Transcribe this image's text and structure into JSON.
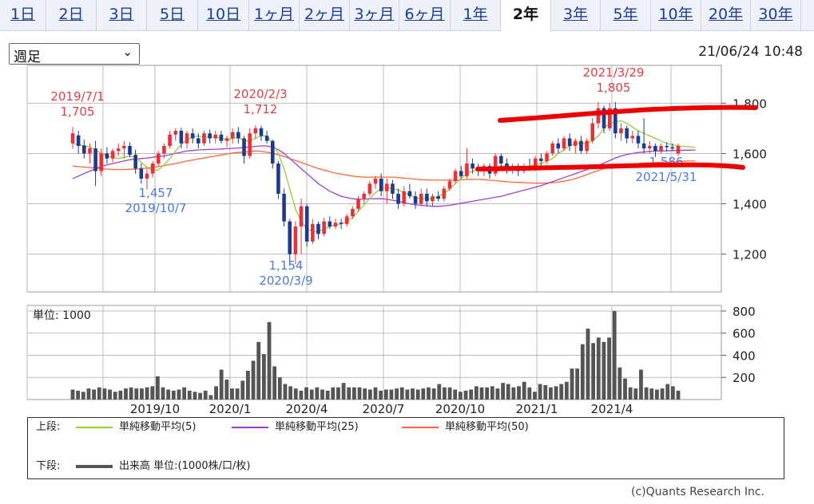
{
  "tabs": [
    {
      "label": "1日"
    },
    {
      "label": "2日"
    },
    {
      "label": "3日"
    },
    {
      "label": "5日"
    },
    {
      "label": "10日"
    },
    {
      "label": "1ヶ月"
    },
    {
      "label": "2ヶ月"
    },
    {
      "label": "3ヶ月"
    },
    {
      "label": "6ヶ月"
    },
    {
      "label": "1年"
    },
    {
      "label": "2年"
    },
    {
      "label": "3年"
    },
    {
      "label": "5年"
    },
    {
      "label": "10年"
    },
    {
      "label": "20年"
    },
    {
      "label": "30年"
    }
  ],
  "active_tab": "2年",
  "period_select": {
    "value": "週足"
  },
  "timestamp": "21/06/24 10:48",
  "colors": {
    "up_candle": "#e8323a",
    "down_candle": "#1d3a8c",
    "ma5": "#9acd32",
    "ma25": "#a040d0",
    "ma50": "#ff6633",
    "volume": "#555555",
    "grid": "#aaaaaa",
    "annotation_high": "#e04040",
    "annotation_low": "#4a78e0",
    "marker": "#ee0000",
    "tab_link": "#1a3c9a"
  },
  "chart_data": [
    {
      "type": "candlestick",
      "ylim": [
        1050,
        1950
      ],
      "y_ticks": [
        "1,800",
        "1,600",
        "1,400",
        "1,200"
      ],
      "x_ticks": [
        "2019/10",
        "2020/1",
        "2020/4",
        "2020/7",
        "2020/10",
        "2021/1",
        "2021/4"
      ],
      "annotations": [
        {
          "date": "2019/7/1",
          "value": "1,705",
          "kind": "high"
        },
        {
          "date": "2020/2/3",
          "value": "1,712",
          "kind": "high"
        },
        {
          "date": "2021/3/29",
          "value": "1,805",
          "kind": "high"
        },
        {
          "date": "2019/10/7",
          "value": "1,457",
          "kind": "low"
        },
        {
          "date": "2020/3/9",
          "value": "1,154",
          "kind": "low"
        },
        {
          "date": "2021/5/31",
          "value": "1,586",
          "kind": "low"
        }
      ],
      "weeks": [
        {
          "o": 1640,
          "h": 1705,
          "l": 1620,
          "c": 1680
        },
        {
          "o": 1672,
          "h": 1690,
          "l": 1600,
          "c": 1630
        },
        {
          "o": 1632,
          "h": 1655,
          "l": 1580,
          "c": 1600
        },
        {
          "o": 1600,
          "h": 1640,
          "l": 1560,
          "c": 1620
        },
        {
          "o": 1620,
          "h": 1650,
          "l": 1470,
          "c": 1530
        },
        {
          "o": 1530,
          "h": 1620,
          "l": 1510,
          "c": 1600
        },
        {
          "o": 1600,
          "h": 1625,
          "l": 1560,
          "c": 1580
        },
        {
          "o": 1580,
          "h": 1620,
          "l": 1565,
          "c": 1610
        },
        {
          "o": 1610,
          "h": 1640,
          "l": 1590,
          "c": 1620
        },
        {
          "o": 1620,
          "h": 1650,
          "l": 1580,
          "c": 1630
        },
        {
          "o": 1630,
          "h": 1645,
          "l": 1585,
          "c": 1595
        },
        {
          "o": 1595,
          "h": 1615,
          "l": 1520,
          "c": 1540
        },
        {
          "o": 1540,
          "h": 1560,
          "l": 1480,
          "c": 1500
        },
        {
          "o": 1500,
          "h": 1540,
          "l": 1457,
          "c": 1520
        },
        {
          "o": 1520,
          "h": 1570,
          "l": 1505,
          "c": 1560
        },
        {
          "o": 1560,
          "h": 1610,
          "l": 1550,
          "c": 1600
        },
        {
          "o": 1600,
          "h": 1640,
          "l": 1580,
          "c": 1630
        },
        {
          "o": 1630,
          "h": 1690,
          "l": 1620,
          "c": 1675
        },
        {
          "o": 1675,
          "h": 1700,
          "l": 1650,
          "c": 1690
        },
        {
          "o": 1690,
          "h": 1702,
          "l": 1620,
          "c": 1640
        },
        {
          "o": 1640,
          "h": 1690,
          "l": 1620,
          "c": 1680
        },
        {
          "o": 1680,
          "h": 1700,
          "l": 1640,
          "c": 1660
        },
        {
          "o": 1660,
          "h": 1680,
          "l": 1620,
          "c": 1640
        },
        {
          "o": 1640,
          "h": 1690,
          "l": 1630,
          "c": 1680
        },
        {
          "o": 1680,
          "h": 1695,
          "l": 1640,
          "c": 1660
        },
        {
          "o": 1660,
          "h": 1690,
          "l": 1640,
          "c": 1675
        },
        {
          "o": 1675,
          "h": 1690,
          "l": 1640,
          "c": 1650
        },
        {
          "o": 1650,
          "h": 1670,
          "l": 1625,
          "c": 1660
        },
        {
          "o": 1660,
          "h": 1700,
          "l": 1640,
          "c": 1685
        },
        {
          "o": 1685,
          "h": 1705,
          "l": 1640,
          "c": 1660
        },
        {
          "o": 1660,
          "h": 1670,
          "l": 1560,
          "c": 1590
        },
        {
          "o": 1590,
          "h": 1700,
          "l": 1580,
          "c": 1680
        },
        {
          "o": 1680,
          "h": 1712,
          "l": 1660,
          "c": 1700
        },
        {
          "o": 1700,
          "h": 1710,
          "l": 1650,
          "c": 1670
        },
        {
          "o": 1670,
          "h": 1690,
          "l": 1640,
          "c": 1650
        },
        {
          "o": 1650,
          "h": 1655,
          "l": 1540,
          "c": 1560
        },
        {
          "o": 1560,
          "h": 1570,
          "l": 1420,
          "c": 1440
        },
        {
          "o": 1440,
          "h": 1460,
          "l": 1310,
          "c": 1330
        },
        {
          "o": 1330,
          "h": 1340,
          "l": 1154,
          "c": 1200
        },
        {
          "o": 1200,
          "h": 1330,
          "l": 1160,
          "c": 1310
        },
        {
          "o": 1310,
          "h": 1420,
          "l": 1200,
          "c": 1390
        },
        {
          "o": 1390,
          "h": 1400,
          "l": 1230,
          "c": 1250
        },
        {
          "o": 1250,
          "h": 1340,
          "l": 1240,
          "c": 1320
        },
        {
          "o": 1320,
          "h": 1330,
          "l": 1260,
          "c": 1280
        },
        {
          "o": 1280,
          "h": 1345,
          "l": 1270,
          "c": 1330
        },
        {
          "o": 1330,
          "h": 1350,
          "l": 1300,
          "c": 1310
        },
        {
          "o": 1310,
          "h": 1340,
          "l": 1300,
          "c": 1325
        },
        {
          "o": 1325,
          "h": 1340,
          "l": 1300,
          "c": 1320
        },
        {
          "o": 1320,
          "h": 1360,
          "l": 1310,
          "c": 1350
        },
        {
          "o": 1350,
          "h": 1390,
          "l": 1340,
          "c": 1380
        },
        {
          "o": 1380,
          "h": 1430,
          "l": 1370,
          "c": 1420
        },
        {
          "o": 1420,
          "h": 1450,
          "l": 1400,
          "c": 1440
        },
        {
          "o": 1440,
          "h": 1490,
          "l": 1430,
          "c": 1480
        },
        {
          "o": 1480,
          "h": 1510,
          "l": 1460,
          "c": 1500
        },
        {
          "o": 1500,
          "h": 1520,
          "l": 1430,
          "c": 1450
        },
        {
          "o": 1450,
          "h": 1500,
          "l": 1400,
          "c": 1480
        },
        {
          "o": 1480,
          "h": 1495,
          "l": 1420,
          "c": 1440
        },
        {
          "o": 1440,
          "h": 1460,
          "l": 1380,
          "c": 1400
        },
        {
          "o": 1400,
          "h": 1470,
          "l": 1390,
          "c": 1450
        },
        {
          "o": 1450,
          "h": 1480,
          "l": 1420,
          "c": 1430
        },
        {
          "o": 1430,
          "h": 1450,
          "l": 1380,
          "c": 1400
        },
        {
          "o": 1400,
          "h": 1460,
          "l": 1390,
          "c": 1440
        },
        {
          "o": 1440,
          "h": 1460,
          "l": 1390,
          "c": 1410
        },
        {
          "o": 1410,
          "h": 1440,
          "l": 1390,
          "c": 1430
        },
        {
          "o": 1430,
          "h": 1450,
          "l": 1410,
          "c": 1420
        },
        {
          "o": 1420,
          "h": 1470,
          "l": 1410,
          "c": 1460
        },
        {
          "o": 1460,
          "h": 1500,
          "l": 1450,
          "c": 1490
        },
        {
          "o": 1490,
          "h": 1540,
          "l": 1480,
          "c": 1530
        },
        {
          "o": 1530,
          "h": 1550,
          "l": 1500,
          "c": 1510
        },
        {
          "o": 1510,
          "h": 1620,
          "l": 1500,
          "c": 1560
        },
        {
          "o": 1560,
          "h": 1580,
          "l": 1520,
          "c": 1540
        },
        {
          "o": 1540,
          "h": 1560,
          "l": 1510,
          "c": 1530
        },
        {
          "o": 1530,
          "h": 1560,
          "l": 1510,
          "c": 1550
        },
        {
          "o": 1550,
          "h": 1560,
          "l": 1500,
          "c": 1520
        },
        {
          "o": 1520,
          "h": 1600,
          "l": 1510,
          "c": 1590
        },
        {
          "o": 1590,
          "h": 1600,
          "l": 1530,
          "c": 1560
        },
        {
          "o": 1560,
          "h": 1580,
          "l": 1520,
          "c": 1540
        },
        {
          "o": 1540,
          "h": 1560,
          "l": 1520,
          "c": 1550
        },
        {
          "o": 1550,
          "h": 1560,
          "l": 1510,
          "c": 1530
        },
        {
          "o": 1530,
          "h": 1560,
          "l": 1520,
          "c": 1550
        },
        {
          "o": 1550,
          "h": 1580,
          "l": 1530,
          "c": 1540
        },
        {
          "o": 1540,
          "h": 1590,
          "l": 1530,
          "c": 1580
        },
        {
          "o": 1580,
          "h": 1600,
          "l": 1550,
          "c": 1570
        },
        {
          "o": 1570,
          "h": 1610,
          "l": 1560,
          "c": 1600
        },
        {
          "o": 1600,
          "h": 1650,
          "l": 1590,
          "c": 1640
        },
        {
          "o": 1640,
          "h": 1660,
          "l": 1600,
          "c": 1620
        },
        {
          "o": 1620,
          "h": 1670,
          "l": 1610,
          "c": 1660
        },
        {
          "o": 1660,
          "h": 1680,
          "l": 1610,
          "c": 1630
        },
        {
          "o": 1630,
          "h": 1660,
          "l": 1600,
          "c": 1650
        },
        {
          "o": 1650,
          "h": 1670,
          "l": 1600,
          "c": 1610
        },
        {
          "o": 1610,
          "h": 1660,
          "l": 1600,
          "c": 1650
        },
        {
          "o": 1650,
          "h": 1740,
          "l": 1640,
          "c": 1720
        },
        {
          "o": 1720,
          "h": 1805,
          "l": 1700,
          "c": 1780
        },
        {
          "o": 1780,
          "h": 1790,
          "l": 1680,
          "c": 1700
        },
        {
          "o": 1700,
          "h": 1800,
          "l": 1690,
          "c": 1780
        },
        {
          "o": 1780,
          "h": 1805,
          "l": 1660,
          "c": 1680
        },
        {
          "o": 1680,
          "h": 1720,
          "l": 1650,
          "c": 1700
        },
        {
          "o": 1700,
          "h": 1710,
          "l": 1640,
          "c": 1660
        },
        {
          "o": 1660,
          "h": 1690,
          "l": 1640,
          "c": 1670
        },
        {
          "o": 1670,
          "h": 1690,
          "l": 1620,
          "c": 1640
        },
        {
          "o": 1640,
          "h": 1740,
          "l": 1600,
          "c": 1620
        },
        {
          "o": 1620,
          "h": 1650,
          "l": 1600,
          "c": 1630
        },
        {
          "o": 1630,
          "h": 1640,
          "l": 1586,
          "c": 1610
        },
        {
          "o": 1610,
          "h": 1640,
          "l": 1600,
          "c": 1630
        },
        {
          "o": 1630,
          "h": 1645,
          "l": 1610,
          "c": 1625
        },
        {
          "o": 1625,
          "h": 1640,
          "l": 1610,
          "c": 1620
        },
        {
          "o": 1600,
          "h": 1640,
          "l": 1590,
          "c": 1630
        }
      ],
      "ma5": [
        1640,
        1635,
        1630,
        1625,
        1615,
        1600,
        1590,
        1585,
        1580,
        1585,
        1590,
        1585,
        1565,
        1545,
        1530,
        1535,
        1555,
        1580,
        1610,
        1635,
        1655,
        1665,
        1670,
        1665,
        1665,
        1665,
        1660,
        1655,
        1660,
        1665,
        1650,
        1650,
        1660,
        1670,
        1670,
        1640,
        1600,
        1540,
        1460,
        1380,
        1330,
        1300,
        1290,
        1290,
        1300,
        1310,
        1315,
        1320,
        1330,
        1345,
        1370,
        1395,
        1420,
        1445,
        1460,
        1465,
        1460,
        1455,
        1445,
        1435,
        1425,
        1420,
        1420,
        1420,
        1430,
        1440,
        1460,
        1480,
        1500,
        1520,
        1530,
        1535,
        1540,
        1540,
        1545,
        1550,
        1550,
        1545,
        1545,
        1545,
        1550,
        1555,
        1560,
        1570,
        1580,
        1600,
        1615,
        1630,
        1640,
        1640,
        1640,
        1650,
        1670,
        1700,
        1720,
        1725,
        1730,
        1720,
        1705,
        1690,
        1680,
        1670,
        1660,
        1650,
        1640,
        1635,
        1630,
        1628,
        1626,
        1625
      ],
      "ma25": [
        1500,
        1510,
        1520,
        1530,
        1540,
        1548,
        1555,
        1560,
        1565,
        1570,
        1575,
        1578,
        1580,
        1582,
        1585,
        1588,
        1590,
        1595,
        1600,
        1605,
        1610,
        1612,
        1614,
        1615,
        1616,
        1617,
        1618,
        1619,
        1620,
        1622,
        1624,
        1626,
        1628,
        1630,
        1630,
        1625,
        1615,
        1600,
        1580,
        1560,
        1540,
        1520,
        1500,
        1480,
        1465,
        1450,
        1440,
        1430,
        1425,
        1420,
        1418,
        1418,
        1420,
        1420,
        1420,
        1418,
        1414,
        1410,
        1405,
        1400,
        1396,
        1394,
        1392,
        1390,
        1390,
        1392,
        1394,
        1398,
        1402,
        1406,
        1410,
        1414,
        1418,
        1422,
        1426,
        1430,
        1436,
        1442,
        1448,
        1454,
        1460,
        1466,
        1472,
        1480,
        1488,
        1496,
        1504,
        1512,
        1520,
        1528,
        1536,
        1544,
        1552,
        1562,
        1572,
        1582,
        1590,
        1596,
        1600,
        1604,
        1606,
        1608,
        1610,
        1610,
        1610,
        1612,
        1612,
        1613,
        1613,
        1614
      ],
      "ma50": [
        1550,
        1548,
        1546,
        1544,
        1542,
        1540,
        1538,
        1536,
        1536,
        1536,
        1537,
        1538,
        1540,
        1542,
        1545,
        1548,
        1552,
        1556,
        1560,
        1565,
        1570,
        1574,
        1578,
        1582,
        1586,
        1590,
        1594,
        1598,
        1602,
        1604,
        1606,
        1608,
        1610,
        1608,
        1605,
        1600,
        1595,
        1588,
        1580,
        1572,
        1564,
        1556,
        1548,
        1540,
        1534,
        1528,
        1522,
        1518,
        1514,
        1510,
        1508,
        1506,
        1506,
        1506,
        1506,
        1506,
        1506,
        1504,
        1502,
        1500,
        1498,
        1496,
        1495,
        1494,
        1494,
        1494,
        1494,
        1494,
        1495,
        1496,
        1497,
        1497,
        1496,
        1494,
        1492,
        1490,
        1488,
        1486,
        1485,
        1484,
        1483,
        1482,
        1482,
        1483,
        1484,
        1486,
        1490,
        1494,
        1500,
        1508,
        1516,
        1524,
        1532,
        1540,
        1546,
        1550,
        1554,
        1556,
        1558,
        1560,
        1562,
        1563,
        1564,
        1565,
        1566,
        1567,
        1568,
        1569,
        1570,
        1570
      ]
    },
    {
      "type": "bar",
      "series_name": "出来高",
      "unit_label": "単位: 1000",
      "ylim": [
        0,
        850
      ],
      "y_ticks": [
        "800",
        "600",
        "400",
        "200"
      ],
      "values": [
        90,
        80,
        70,
        100,
        90,
        110,
        100,
        90,
        70,
        80,
        100,
        110,
        100,
        100,
        110,
        120,
        210,
        110,
        90,
        80,
        90,
        110,
        80,
        70,
        60,
        80,
        40,
        120,
        270,
        180,
        100,
        100,
        170,
        260,
        350,
        520,
        410,
        700,
        300,
        200,
        140,
        120,
        100,
        80,
        110,
        90,
        110,
        90,
        80,
        110,
        110,
        150,
        110,
        110,
        110,
        100,
        90,
        110,
        80,
        90,
        90,
        100,
        110,
        90,
        100,
        90,
        100,
        110,
        100,
        140,
        110,
        110,
        90,
        70,
        80,
        90,
        120,
        110,
        110,
        120,
        100,
        150,
        140,
        110,
        120,
        160,
        110,
        70,
        140,
        130,
        110,
        120,
        140,
        160,
        280,
        280,
        500,
        640,
        510,
        560,
        520,
        560,
        800,
        290,
        190,
        110,
        100,
        270,
        110,
        100,
        90,
        100,
        140,
        120,
        80
      ]
    }
  ],
  "legend": {
    "upper_label": "上段:",
    "lower_label": "下段:",
    "ma5": "単純移動平均(5)",
    "ma25": "単純移動平均(25)",
    "ma50": "単純移動平均(50)",
    "volume": "出来高 単位:(1000株/口/枚)"
  },
  "copyright": "(c)Quants Research Inc."
}
